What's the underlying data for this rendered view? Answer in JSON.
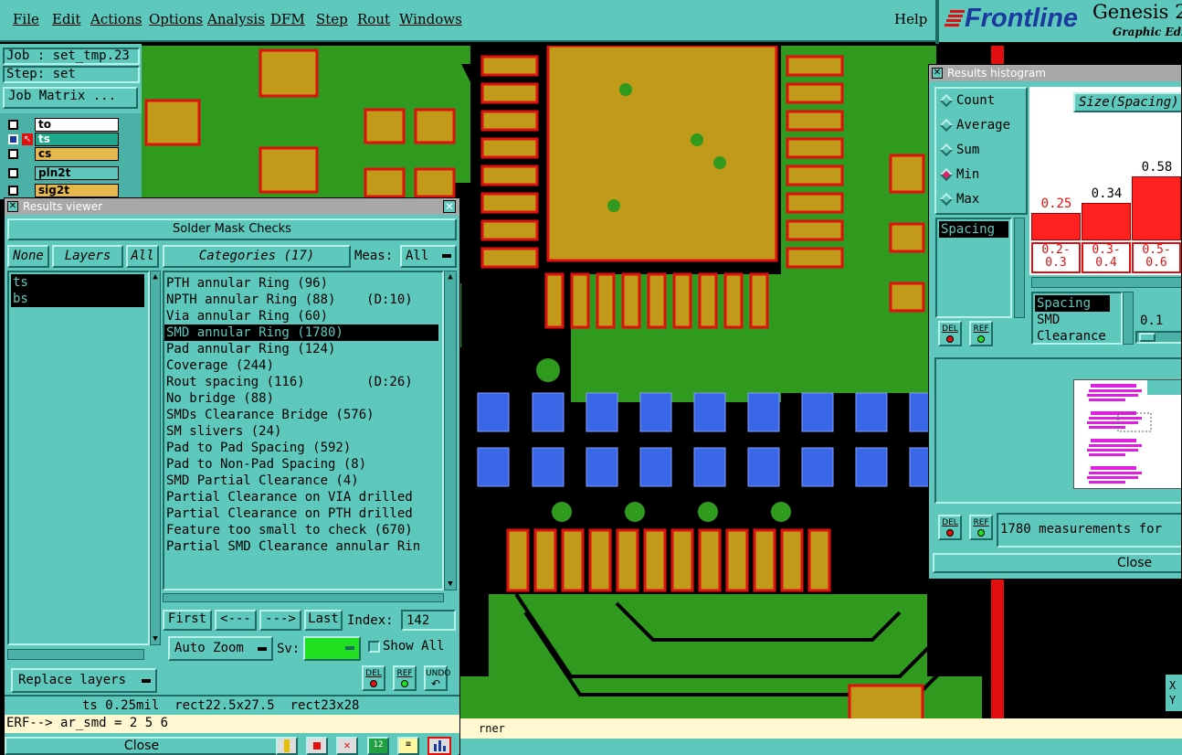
{
  "menubar": {
    "items": [
      "File",
      "Edit",
      "Actions",
      "Options",
      "Analysis",
      "DFM",
      "Step",
      "Rout",
      "Windows"
    ],
    "help": "Help"
  },
  "brand": {
    "logo": "Frontline",
    "product": "Genesis 2",
    "subtitle": "Graphic Edi"
  },
  "left_panel": {
    "job": "Job : set_tmp.23",
    "step": "Step: set",
    "job_matrix": "Job Matrix ...",
    "layers": [
      {
        "name": "to",
        "color": "#ffffff"
      },
      {
        "name": "ts",
        "color": "#1fa88c"
      },
      {
        "name": "cs",
        "color": "#e6b84c"
      },
      {
        "name": "pln2t",
        "color": "#5fc8bc"
      },
      {
        "name": "sig2t",
        "color": "#e6b84c"
      }
    ]
  },
  "results_viewer": {
    "title": "Results viewer",
    "header": "Solder Mask Checks",
    "none_btn": "None",
    "layers_btn": "Layers",
    "all_btn": "All",
    "layer_list": [
      "ts",
      "bs"
    ],
    "categories_btn": "Categories (17)",
    "meas_label": "Meas:",
    "meas_value": "All",
    "categories": [
      "PTH annular Ring (96)",
      "NPTH annular Ring (88)    (D:10)",
      "Via annular Ring (60)",
      "SMD annular Ring (1780)",
      "Pad annular Ring (124)",
      "Coverage (244)",
      "Rout spacing (116)        (D:26)",
      "No bridge (88)",
      "SMDs Clearance Bridge (576)",
      "SM slivers (24)",
      "Pad to Pad Spacing (592)",
      "Pad to Non-Pad Spacing (8)",
      "SMD Partial Clearance (4)",
      "Partial Clearance on VIA drilled",
      "Partial Clearance on PTH drilled",
      "Feature too small to check (670)",
      "Partial SMD Clearance annular Rin"
    ],
    "selected_index": 3,
    "first": "First",
    "prev": "<---",
    "next": "--->",
    "last": "Last",
    "index_label": "Index:",
    "index_value": "142",
    "auto_zoom": "Auto Zoom",
    "sv_label": "Sv:",
    "show_all": "Show All",
    "replace_layers": "Replace layers",
    "del": "DEL",
    "ref": "REF",
    "undo": "UNDO",
    "close": "Close"
  },
  "status": {
    "measure": "ts 0.25mil  rect22.5x27.5  rect23x28",
    "erf": "ERF--> ar_smd = 2 5 6",
    "bottom_msg": "rner"
  },
  "histogram": {
    "title": "Results histogram",
    "modes": [
      "Count",
      "Average",
      "Sum",
      "Min",
      "Max"
    ],
    "selected_mode": 3,
    "size_label": "Size(Spacing)",
    "spacing_item": "Spacing",
    "bars": [
      {
        "label": "0.25",
        "range": [
          "0.2-",
          "0.3"
        ],
        "value": 0.25
      },
      {
        "label": "0.34",
        "range": [
          "0.3-",
          "0.4"
        ],
        "value": 0.34
      },
      {
        "label": "0.58",
        "range": [
          "0.5-",
          "0.6"
        ],
        "value": 0.58
      }
    ],
    "list2": [
      "Spacing",
      "SMD",
      "Clearance"
    ],
    "slider_value": "0.1",
    "measurements": "1780 measurements for ",
    "close": "Close",
    "del": "DEL",
    "ref": "REF"
  },
  "coords": {
    "x": "X",
    "y": "Y"
  }
}
